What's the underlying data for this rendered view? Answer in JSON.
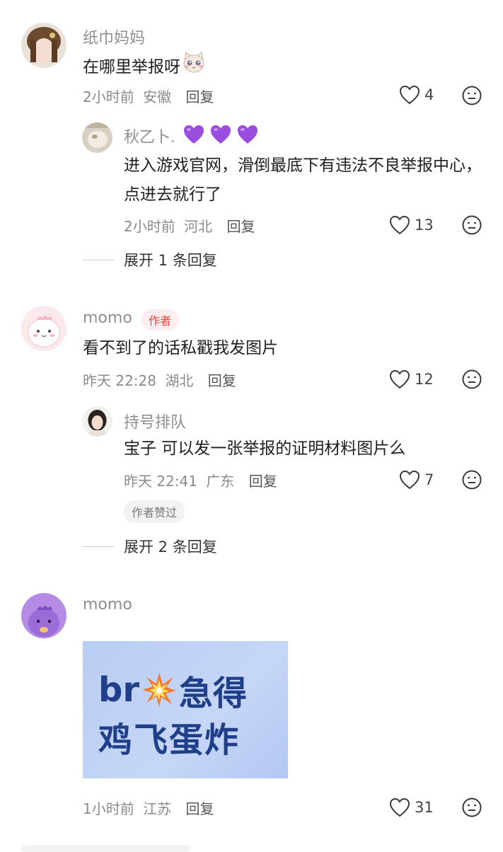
{
  "comments": [
    {
      "username": "纸巾妈妈",
      "text": "在哪里举报呀",
      "time": "2小时前",
      "location": "安徽",
      "reply_label": "回复",
      "likes": "4",
      "replies": [
        {
          "username": "秋乙卜.",
          "text": "进入游戏官网，滑倒最底下有违法不良举报中心，点进去就行了",
          "time": "2小时前",
          "location": "河北",
          "reply_label": "回复",
          "likes": "13"
        }
      ],
      "expand_label": "展开 1 条回复"
    },
    {
      "username": "momo",
      "author_badge": "作者",
      "text": "看不到了的话私戳我发图片",
      "time": "昨天 22:28",
      "location": "湖北",
      "reply_label": "回复",
      "likes": "12",
      "replies": [
        {
          "username": "持号排队",
          "text": "宝子 可以发一张举报的证明材料图片么",
          "time": "昨天 22:41",
          "location": "广东",
          "reply_label": "回复",
          "likes": "7",
          "badge": "作者赞过"
        }
      ],
      "expand_label": "展开 2 条回复"
    },
    {
      "username": "momo",
      "image_text_line1_a": "br",
      "image_text_line1_b": "急得",
      "image_text_line2": "鸡飞蛋炸",
      "time": "1小时前",
      "location": "江苏",
      "reply_label": "回复",
      "likes": "31"
    }
  ],
  "colors": {
    "heart_emoji": "#9b4de0",
    "author_badge": "#e8423f",
    "image_text": "#1f3f8a"
  }
}
